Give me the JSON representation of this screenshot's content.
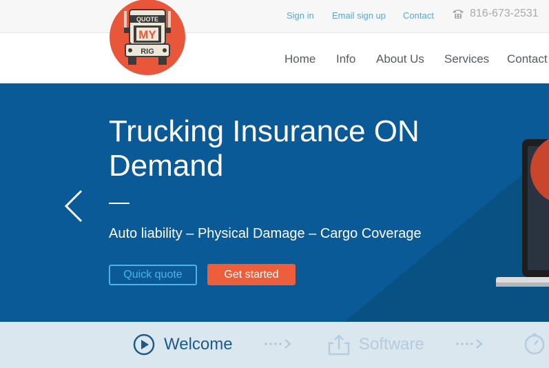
{
  "topbar": {
    "sign_in": "Sign in",
    "email_sign_up": "Email sign up",
    "contact": "Contact",
    "phone": "816-673-2531"
  },
  "logo": {
    "line1": "QUOTE",
    "line2": "MY",
    "line3": "RIG",
    "color": "#e8573a"
  },
  "nav": {
    "items": [
      "Home",
      "Info",
      "About Us",
      "Services",
      "Contact"
    ]
  },
  "hero": {
    "title": "Trucking Insurance ON Demand",
    "subtitle": "Auto liability – Physical Damage – Cargo Coverage",
    "quick_quote": "Quick quote",
    "get_started": "Get started",
    "background": "#0a5a97"
  },
  "steps": {
    "items": [
      "Welcome",
      "Software"
    ]
  }
}
